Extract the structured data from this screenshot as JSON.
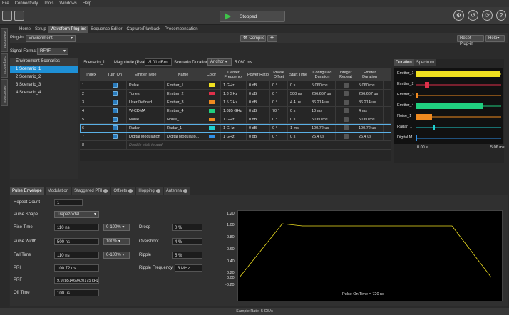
{
  "menu": [
    "File",
    "Connectivity",
    "Tools",
    "Windows",
    "Help"
  ],
  "toolbar": {
    "status_label": "Stopped"
  },
  "side_tabs": [
    "Waveforms",
    "Sequences",
    "Connections"
  ],
  "tabs": [
    "Home",
    "Setup",
    "Waveform Plug-ins",
    "Sequence Editor",
    "Capture/Playback",
    "Precompensation"
  ],
  "plugin": {
    "label": "Plug-in:",
    "value": "Environment",
    "compile": "Compile",
    "reset": "Reset Plug-in",
    "help": "Help"
  },
  "signal_format": {
    "label": "Signal Format",
    "value": "RF/IF"
  },
  "env": {
    "header": "Environment Scenarios",
    "items": [
      "1   Scenario_1",
      "2   Scenario_2",
      "3   Scenario_3",
      "4   Scenario_4"
    ]
  },
  "scenario": {
    "name": "Scenario_1:",
    "mag_label": "Magnitude (Peak)",
    "mag_value": "-5.01 dBm",
    "dur_label": "Scenario Duration",
    "anchor": "Anchor",
    "dur_value": "5.060 ms"
  },
  "table": {
    "headers": [
      "Index",
      "Turn On",
      "Emitter Type",
      "Name",
      "Color",
      "Center Frequency",
      "Power Ratio",
      "Phase Offset",
      "Start Time",
      "Configured Duration",
      "Integer Repeat",
      "Emitter Duration"
    ],
    "rows": [
      [
        "1",
        "Pulse",
        "Emitter_1",
        "1 GHz",
        "0 dB",
        "0 °",
        "0 s",
        "5.060 ms",
        "5.060 ms"
      ],
      [
        "2",
        "Tones",
        "Emitter_2",
        "1.3 GHz",
        "0 dB",
        "0 °",
        "500 us",
        "266.667 us",
        "266.667 us"
      ],
      [
        "3",
        "User Defined",
        "Emitter_3",
        "1.5 GHz",
        "0 dB",
        "0 °",
        "4.4 us",
        "86.214 us",
        "86.214 us"
      ],
      [
        "4",
        "W-CDMA",
        "Emitter_4",
        "1.885 GHz",
        "0 dB",
        "70 °",
        "0 s",
        "10 ms",
        "4 ms"
      ],
      [
        "5",
        "Noise",
        "Noise_1",
        "1 GHz",
        "0 dB",
        "0 °",
        "0 s",
        "5.060 ms",
        "5.060 ms"
      ],
      [
        "6",
        "Radar",
        "Radar_1",
        "1 GHz",
        "0 dB",
        "0 °",
        "1 ms",
        "100.72 us",
        "100.72 us"
      ],
      [
        "7",
        "Digital Modulation",
        "Digital Modulatio...",
        "1 GHz",
        "0 dB",
        "0 °",
        "0 s",
        "25.4 us",
        "25.4 us"
      ]
    ],
    "row_colors": [
      "#f0e020",
      "#e0304a",
      "#f08a20",
      "#20d080",
      "#f08a20",
      "#20d0d0",
      "#3090e8"
    ],
    "add_index": "8",
    "add_hint": "Double click to add"
  },
  "duration_panel": {
    "tabs": [
      "Duration",
      "Spectrum"
    ],
    "labels": [
      "Emitter_1",
      "Emitter_2",
      "Emitter_3",
      "Emitter_4",
      "Noise_1",
      "Radar_1",
      "Digital M..."
    ],
    "axis_start": "0.00 s",
    "axis_end": "5.06 ms"
  },
  "bottom_tabs": [
    "Pulse Envelope",
    "Modulation",
    "Staggered PRI",
    "Offsets",
    "Hopping",
    "Antenna"
  ],
  "form": {
    "repeat_count_label": "Repeat Count",
    "repeat_count": "1",
    "pulse_shape_label": "Pulse Shape",
    "pulse_shape": "Trapezoidal",
    "rise_time_label": "Rise Time",
    "rise_time": "110 ns",
    "rise_range": "0-100%",
    "pulse_width_label": "Pulse Width",
    "pulse_width": "500 ns",
    "pw_range": "100%",
    "fall_time_label": "Fall Time",
    "fall_time": "110 ns",
    "fall_range": "0-100%",
    "pri_label": "PRI",
    "pri": "100.72 us",
    "prf_label": "PRF",
    "prf": "9.92851469420175 kHz",
    "off_time_label": "Off Time",
    "off_time": "100 us",
    "droop_label": "Droop",
    "droop": "0 %",
    "overshoot_label": "Overshoot",
    "overshoot": "4 %",
    "ripple_label": "Ripple",
    "ripple": "5 %",
    "ripple_freq_label": "Ripple Frequency",
    "ripple_freq": "3 MHz"
  },
  "plot": {
    "yticks": [
      "1.20",
      "1.00",
      "0.80",
      "0.60",
      "0.40",
      "0.20",
      "0.00",
      "-0.20"
    ],
    "annotation": "Pulse On Time = 720 ns"
  },
  "status": "Sample Rate: 5 GS/s"
}
